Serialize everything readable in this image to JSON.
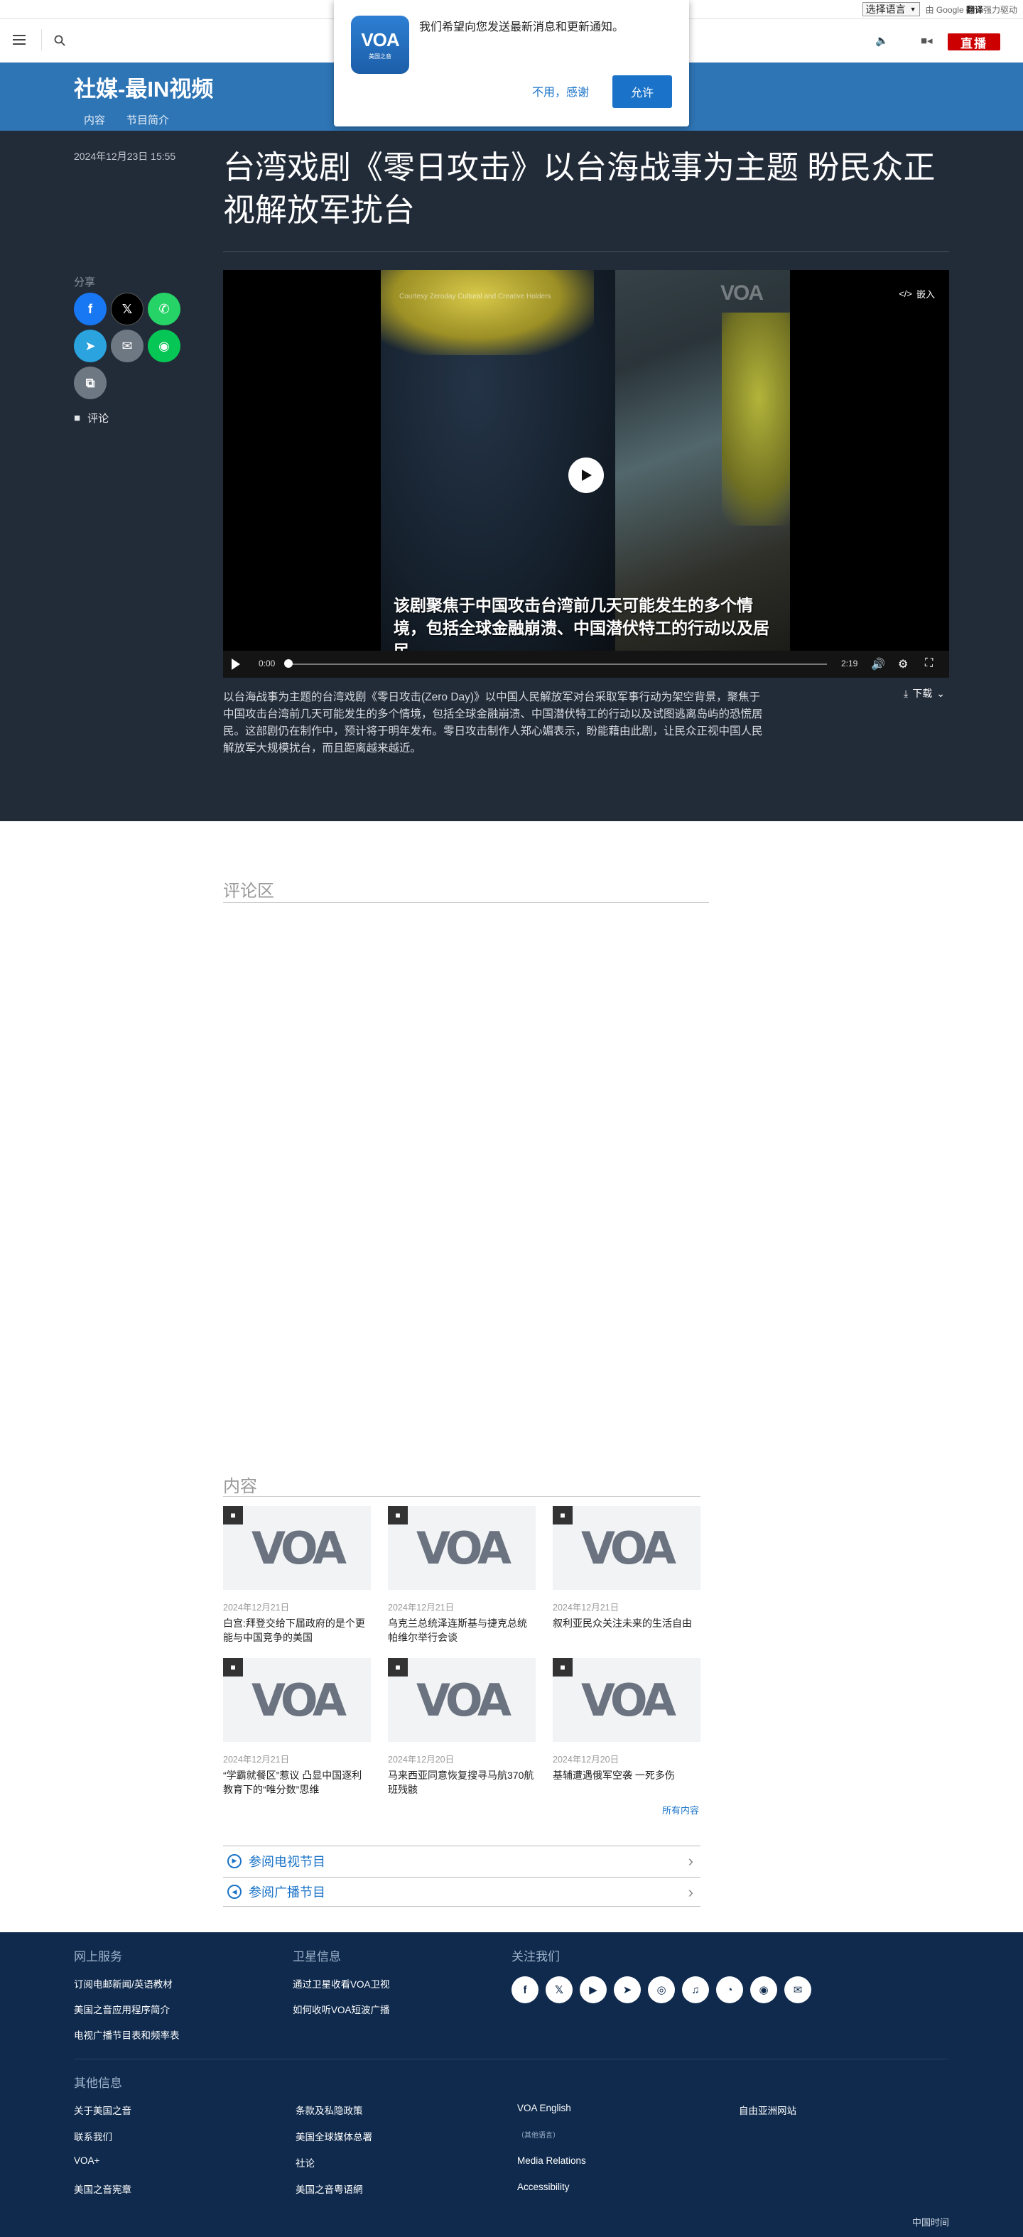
{
  "translate_bar": {
    "select_label": "选择语言",
    "powered_prefix": "由",
    "google": "Google",
    "translate_word": "翻译",
    "powered_suffix": "强力驱动"
  },
  "header": {
    "live_label": "直播"
  },
  "program": {
    "title": "社媒-最IN视频",
    "tabs": [
      {
        "label": "内容"
      },
      {
        "label": "节目简介"
      }
    ]
  },
  "notification": {
    "logo_text": "VOA",
    "logo_sub": "美国之音",
    "message": "我们希望向您发送最新消息和更新通知。",
    "decline_label": "不用，感谢",
    "allow_label": "允许"
  },
  "article": {
    "date": "2024年12月23日 15:55",
    "title": "台湾戏剧《零日攻击》以台海战事为主题 盼民众正视解放军扰台",
    "share_label": "分享",
    "comment_label": "评论",
    "summary": "以台海战事为主题的台湾戏剧《零日攻击(Zero Day)》以中国人民解放军对台采取军事行动为架空背景，聚焦于中国攻击台湾前几天可能发生的多个情境，包括全球金融崩溃、中国潜伏特工的行动以及试图逃离岛屿的恐慌居民。这部剧仍在制作中，预计将于明年发布。零日攻击制作人郑心媚表示，盼能藉由此剧，让民众正视中国人民解放军大规模扰台，而且距离越来越近。",
    "download_label": "下载"
  },
  "video": {
    "credit": "Courtesy Zeroday Cultural and Creative Holders",
    "watermark": "VOA",
    "subtitle": "该剧聚焦于中国攻击台湾前几天可能发生的多个情境，包括全球金融崩溃、中国潜伏特工的行动以及居民",
    "embed_label": "嵌入",
    "current_time": "0:00",
    "duration": "2:19"
  },
  "comments": {
    "heading": "评论区"
  },
  "related": {
    "heading": "内容",
    "logo_text": "VOA",
    "all_label": "所有内容",
    "items": [
      {
        "date": "2024年12月21日",
        "title": "白宫:拜登交给下届政府的是个更能与中国竞争的美国"
      },
      {
        "date": "2024年12月21日",
        "title": "乌克兰总统泽连斯基与捷克总统帕维尔举行会谈"
      },
      {
        "date": "2024年12月21日",
        "title": "叙利亚民众关注未来的生活自由"
      },
      {
        "date": "2024年12月21日",
        "title": "“学霸就餐区”惹议 凸显中国逐利教育下的“唯分数”思维"
      },
      {
        "date": "2024年12月20日",
        "title": "马来西亚同意恢复搜寻马航370航班残骸"
      },
      {
        "date": "2024年12月20日",
        "title": "基辅遭遇俄军空袭 一死多伤"
      }
    ],
    "schedules": [
      {
        "label": "参阅电视节目"
      },
      {
        "label": "参阅广播节目"
      }
    ]
  },
  "footer": {
    "online_heading": "网上服务",
    "online_links": [
      "订阅电邮新闻/英语教材",
      "美国之音应用程序简介",
      "电视广播节目表和频率表"
    ],
    "satellite_heading": "卫星信息",
    "satellite_links": [
      "通过卫星收看VOA卫视",
      "如何收听VOA短波广播"
    ],
    "follow_heading": "关注我们",
    "social": [
      "facebook-icon",
      "x-icon",
      "youtube-icon",
      "telegram-icon",
      "instagram-icon",
      "podcast-icon",
      "rss-icon",
      "podcast2-icon",
      "email-icon"
    ],
    "other_heading": "其他信息",
    "other_col1": [
      "关于美国之音",
      "联系我们",
      "VOA+",
      "美国之音宪章"
    ],
    "other_col2": [
      "条款及私隐政策",
      "美国全球媒体总署",
      "社论",
      "美国之音粤语網"
    ],
    "other_col3": [
      "VOA English",
      "（其他语言）",
      "Media Relations",
      "Accessibility"
    ],
    "other_col4": [
      "自由亚洲网站"
    ],
    "time_label": "中国时间"
  }
}
